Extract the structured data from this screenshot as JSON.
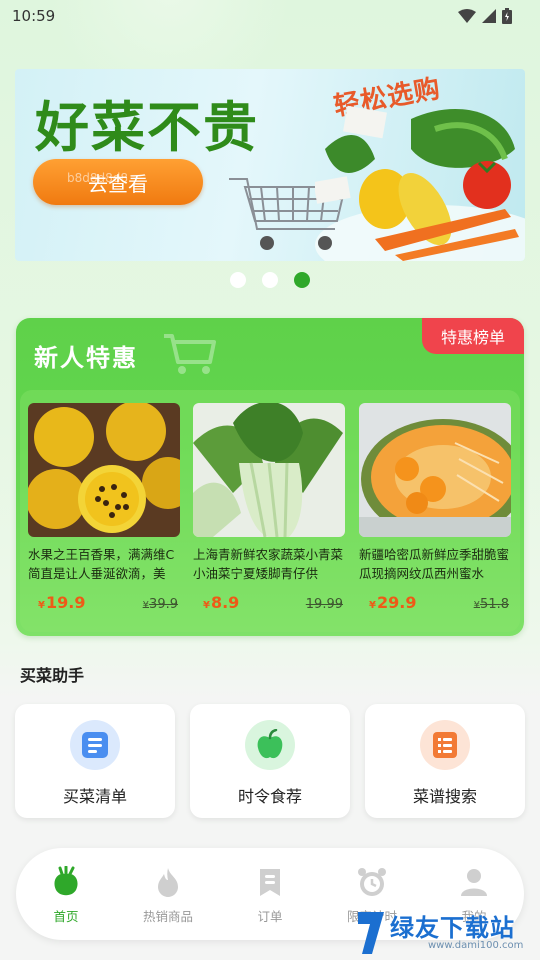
{
  "status_bar": {
    "time": "10:59"
  },
  "banner": {
    "title": "好菜不贵",
    "slogan": "轻松选购",
    "button_label": "去查看",
    "watermark": "b8d8d8d8"
  },
  "carousel": {
    "count": 3,
    "active_index": 2
  },
  "promo": {
    "title": "新人特惠",
    "badge": "特惠榜单",
    "products": [
      {
        "name": "水果之王百香果，满满维C简直是让人垂涎欲滴，美",
        "currency": "¥",
        "price": "19.9",
        "original_price": "39.9"
      },
      {
        "name": "上海青新鲜农家蔬菜小青菜小油菜宁夏矮脚青仔供",
        "currency": "¥",
        "price": "8.9",
        "original_price": "19.99"
      },
      {
        "name": "新疆哈密瓜新鲜应季甜脆蜜瓜现摘网纹瓜西州蜜水",
        "currency": "¥",
        "price": "29.9",
        "original_price": "51.8"
      }
    ]
  },
  "helper": {
    "title": "买菜助手",
    "items": [
      {
        "label": "买菜清单",
        "icon": "list-icon",
        "color": "#4a8ef0"
      },
      {
        "label": "时令食荐",
        "icon": "apple-icon",
        "color": "#3cc05a"
      },
      {
        "label": "菜谱搜索",
        "icon": "recipe-icon",
        "color": "#f27a35"
      }
    ]
  },
  "nav": {
    "items": [
      {
        "label": "首页",
        "icon": "home-veggie-icon"
      },
      {
        "label": "热销商品",
        "icon": "hot-flame-icon"
      },
      {
        "label": "订单",
        "icon": "order-icon"
      },
      {
        "label": "限定计时",
        "icon": "alarm-clock-icon"
      },
      {
        "label": "我的",
        "icon": "profile-icon"
      }
    ],
    "active_index": 0
  },
  "watermark": {
    "title": "绿友下载站",
    "url": "www.dami100.com"
  },
  "colors": {
    "brand_green": "#2fa82a",
    "promo_green": "#5fd14a",
    "price_orange": "#ee5a17",
    "badge_red": "#f0444c"
  }
}
